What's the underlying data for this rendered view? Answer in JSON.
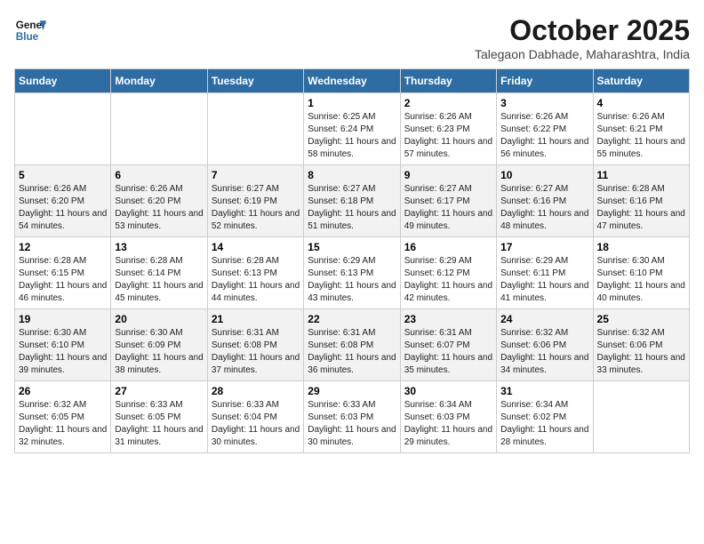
{
  "header": {
    "logo_line1": "General",
    "logo_line2": "Blue",
    "month": "October 2025",
    "location": "Talegaon Dabhade, Maharashtra, India"
  },
  "weekdays": [
    "Sunday",
    "Monday",
    "Tuesday",
    "Wednesday",
    "Thursday",
    "Friday",
    "Saturday"
  ],
  "weeks": [
    [
      {
        "day": "",
        "sunrise": "",
        "sunset": "",
        "daylight": ""
      },
      {
        "day": "",
        "sunrise": "",
        "sunset": "",
        "daylight": ""
      },
      {
        "day": "",
        "sunrise": "",
        "sunset": "",
        "daylight": ""
      },
      {
        "day": "1",
        "sunrise": "Sunrise: 6:25 AM",
        "sunset": "Sunset: 6:24 PM",
        "daylight": "Daylight: 11 hours and 58 minutes."
      },
      {
        "day": "2",
        "sunrise": "Sunrise: 6:26 AM",
        "sunset": "Sunset: 6:23 PM",
        "daylight": "Daylight: 11 hours and 57 minutes."
      },
      {
        "day": "3",
        "sunrise": "Sunrise: 6:26 AM",
        "sunset": "Sunset: 6:22 PM",
        "daylight": "Daylight: 11 hours and 56 minutes."
      },
      {
        "day": "4",
        "sunrise": "Sunrise: 6:26 AM",
        "sunset": "Sunset: 6:21 PM",
        "daylight": "Daylight: 11 hours and 55 minutes."
      }
    ],
    [
      {
        "day": "5",
        "sunrise": "Sunrise: 6:26 AM",
        "sunset": "Sunset: 6:20 PM",
        "daylight": "Daylight: 11 hours and 54 minutes."
      },
      {
        "day": "6",
        "sunrise": "Sunrise: 6:26 AM",
        "sunset": "Sunset: 6:20 PM",
        "daylight": "Daylight: 11 hours and 53 minutes."
      },
      {
        "day": "7",
        "sunrise": "Sunrise: 6:27 AM",
        "sunset": "Sunset: 6:19 PM",
        "daylight": "Daylight: 11 hours and 52 minutes."
      },
      {
        "day": "8",
        "sunrise": "Sunrise: 6:27 AM",
        "sunset": "Sunset: 6:18 PM",
        "daylight": "Daylight: 11 hours and 51 minutes."
      },
      {
        "day": "9",
        "sunrise": "Sunrise: 6:27 AM",
        "sunset": "Sunset: 6:17 PM",
        "daylight": "Daylight: 11 hours and 49 minutes."
      },
      {
        "day": "10",
        "sunrise": "Sunrise: 6:27 AM",
        "sunset": "Sunset: 6:16 PM",
        "daylight": "Daylight: 11 hours and 48 minutes."
      },
      {
        "day": "11",
        "sunrise": "Sunrise: 6:28 AM",
        "sunset": "Sunset: 6:16 PM",
        "daylight": "Daylight: 11 hours and 47 minutes."
      }
    ],
    [
      {
        "day": "12",
        "sunrise": "Sunrise: 6:28 AM",
        "sunset": "Sunset: 6:15 PM",
        "daylight": "Daylight: 11 hours and 46 minutes."
      },
      {
        "day": "13",
        "sunrise": "Sunrise: 6:28 AM",
        "sunset": "Sunset: 6:14 PM",
        "daylight": "Daylight: 11 hours and 45 minutes."
      },
      {
        "day": "14",
        "sunrise": "Sunrise: 6:28 AM",
        "sunset": "Sunset: 6:13 PM",
        "daylight": "Daylight: 11 hours and 44 minutes."
      },
      {
        "day": "15",
        "sunrise": "Sunrise: 6:29 AM",
        "sunset": "Sunset: 6:13 PM",
        "daylight": "Daylight: 11 hours and 43 minutes."
      },
      {
        "day": "16",
        "sunrise": "Sunrise: 6:29 AM",
        "sunset": "Sunset: 6:12 PM",
        "daylight": "Daylight: 11 hours and 42 minutes."
      },
      {
        "day": "17",
        "sunrise": "Sunrise: 6:29 AM",
        "sunset": "Sunset: 6:11 PM",
        "daylight": "Daylight: 11 hours and 41 minutes."
      },
      {
        "day": "18",
        "sunrise": "Sunrise: 6:30 AM",
        "sunset": "Sunset: 6:10 PM",
        "daylight": "Daylight: 11 hours and 40 minutes."
      }
    ],
    [
      {
        "day": "19",
        "sunrise": "Sunrise: 6:30 AM",
        "sunset": "Sunset: 6:10 PM",
        "daylight": "Daylight: 11 hours and 39 minutes."
      },
      {
        "day": "20",
        "sunrise": "Sunrise: 6:30 AM",
        "sunset": "Sunset: 6:09 PM",
        "daylight": "Daylight: 11 hours and 38 minutes."
      },
      {
        "day": "21",
        "sunrise": "Sunrise: 6:31 AM",
        "sunset": "Sunset: 6:08 PM",
        "daylight": "Daylight: 11 hours and 37 minutes."
      },
      {
        "day": "22",
        "sunrise": "Sunrise: 6:31 AM",
        "sunset": "Sunset: 6:08 PM",
        "daylight": "Daylight: 11 hours and 36 minutes."
      },
      {
        "day": "23",
        "sunrise": "Sunrise: 6:31 AM",
        "sunset": "Sunset: 6:07 PM",
        "daylight": "Daylight: 11 hours and 35 minutes."
      },
      {
        "day": "24",
        "sunrise": "Sunrise: 6:32 AM",
        "sunset": "Sunset: 6:06 PM",
        "daylight": "Daylight: 11 hours and 34 minutes."
      },
      {
        "day": "25",
        "sunrise": "Sunrise: 6:32 AM",
        "sunset": "Sunset: 6:06 PM",
        "daylight": "Daylight: 11 hours and 33 minutes."
      }
    ],
    [
      {
        "day": "26",
        "sunrise": "Sunrise: 6:32 AM",
        "sunset": "Sunset: 6:05 PM",
        "daylight": "Daylight: 11 hours and 32 minutes."
      },
      {
        "day": "27",
        "sunrise": "Sunrise: 6:33 AM",
        "sunset": "Sunset: 6:05 PM",
        "daylight": "Daylight: 11 hours and 31 minutes."
      },
      {
        "day": "28",
        "sunrise": "Sunrise: 6:33 AM",
        "sunset": "Sunset: 6:04 PM",
        "daylight": "Daylight: 11 hours and 30 minutes."
      },
      {
        "day": "29",
        "sunrise": "Sunrise: 6:33 AM",
        "sunset": "Sunset: 6:03 PM",
        "daylight": "Daylight: 11 hours and 30 minutes."
      },
      {
        "day": "30",
        "sunrise": "Sunrise: 6:34 AM",
        "sunset": "Sunset: 6:03 PM",
        "daylight": "Daylight: 11 hours and 29 minutes."
      },
      {
        "day": "31",
        "sunrise": "Sunrise: 6:34 AM",
        "sunset": "Sunset: 6:02 PM",
        "daylight": "Daylight: 11 hours and 28 minutes."
      },
      {
        "day": "",
        "sunrise": "",
        "sunset": "",
        "daylight": ""
      }
    ]
  ]
}
